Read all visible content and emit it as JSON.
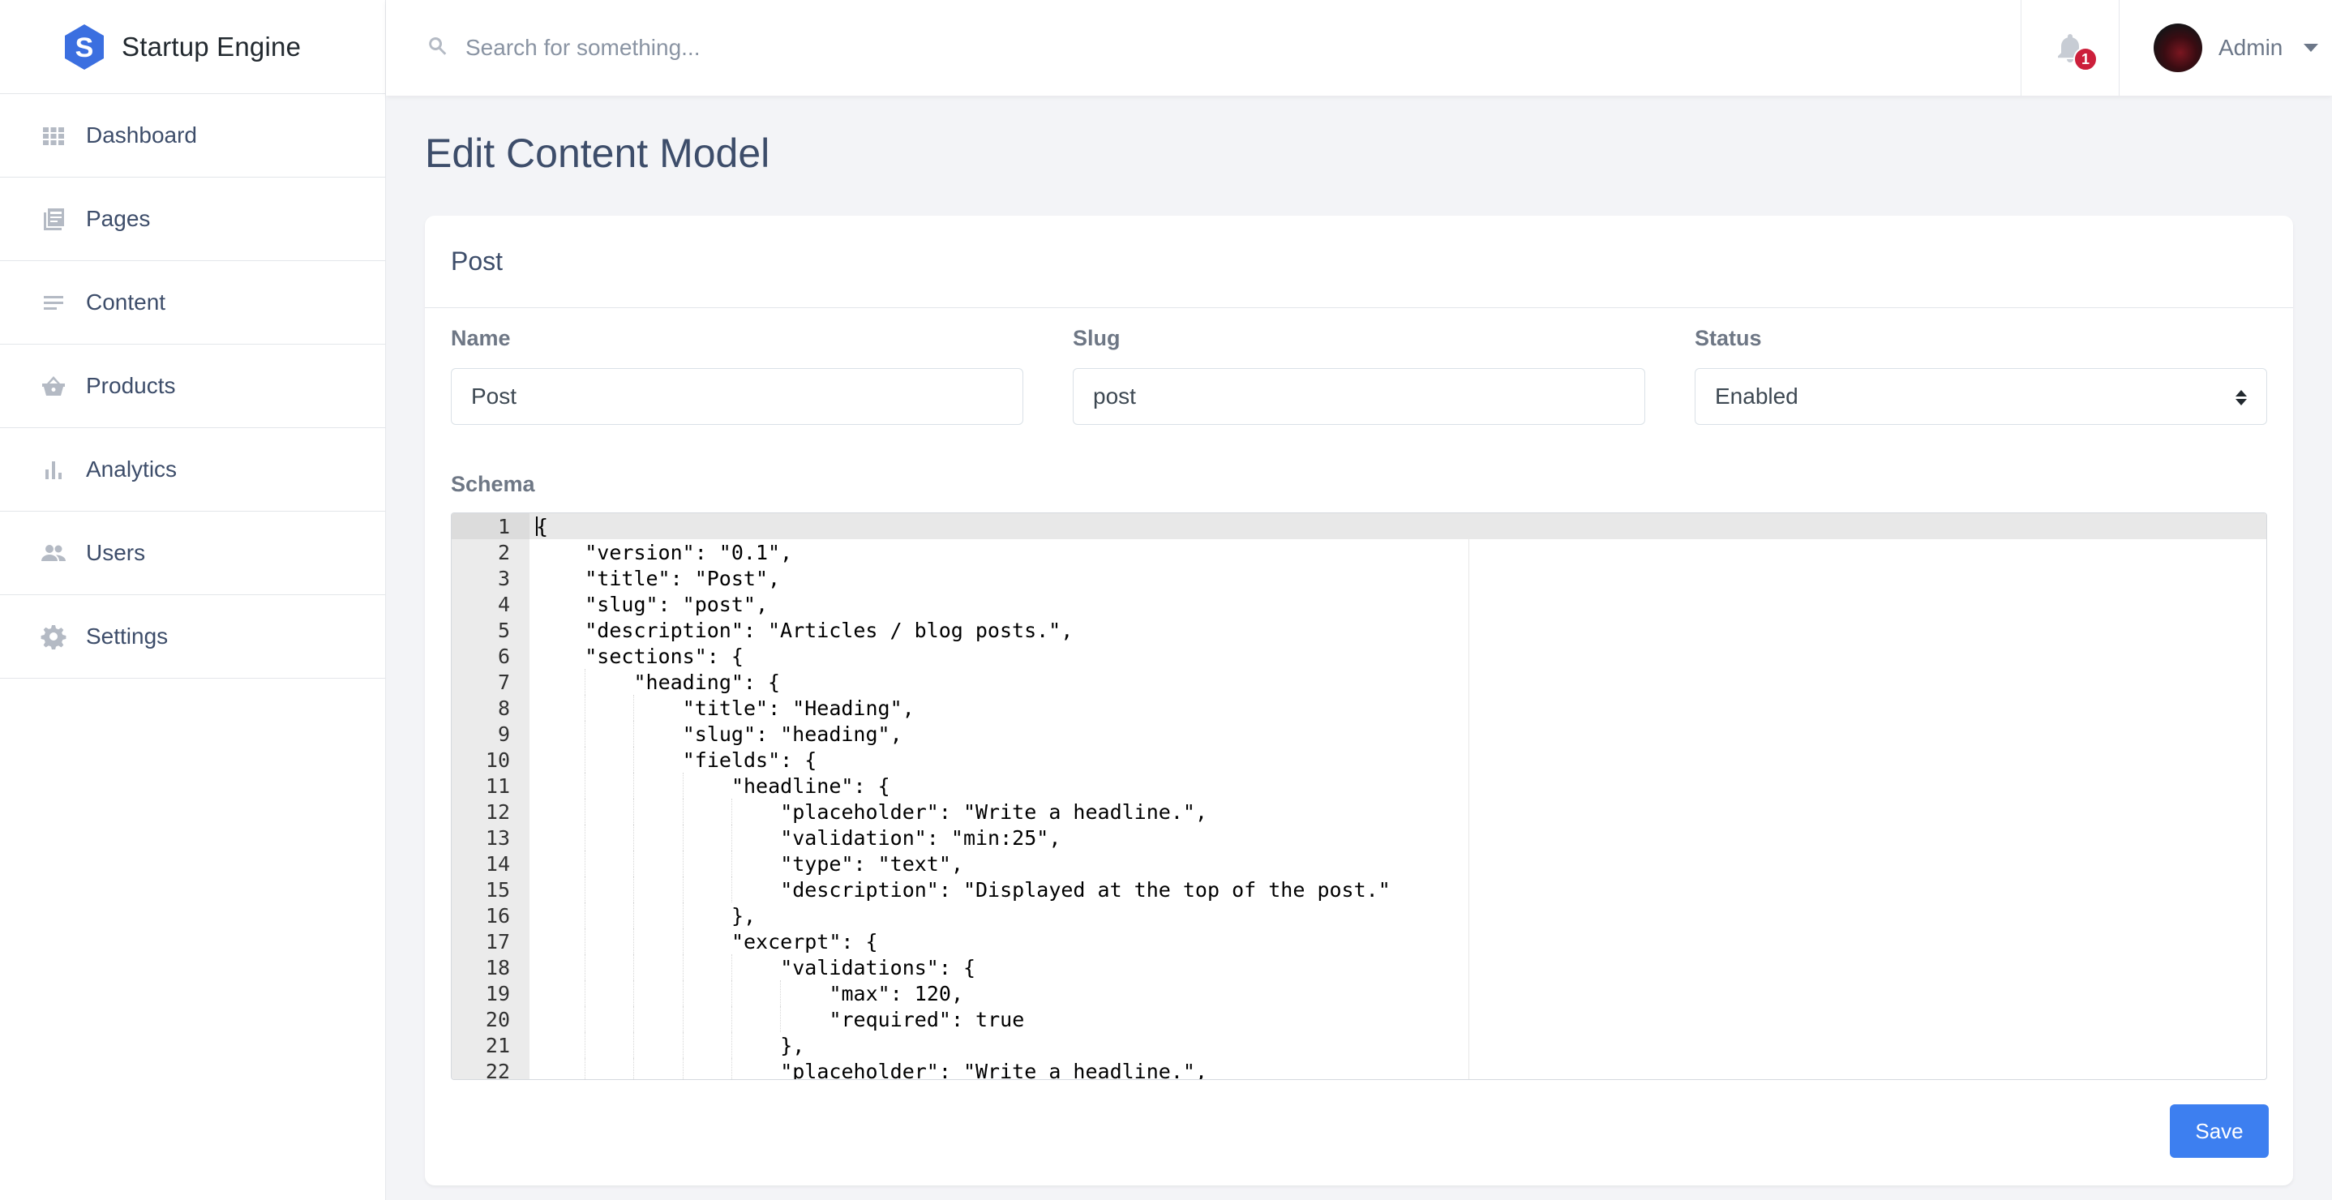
{
  "brand": {
    "name": "Startup Engine",
    "logo_letter": "S"
  },
  "sidebar": {
    "items": [
      {
        "label": "Dashboard",
        "icon": "grid-icon"
      },
      {
        "label": "Pages",
        "icon": "pages-icon"
      },
      {
        "label": "Content",
        "icon": "lines-icon"
      },
      {
        "label": "Products",
        "icon": "basket-icon"
      },
      {
        "label": "Analytics",
        "icon": "bar-chart-icon"
      },
      {
        "label": "Users",
        "icon": "users-icon"
      },
      {
        "label": "Settings",
        "icon": "gear-icon"
      }
    ]
  },
  "topbar": {
    "search_placeholder": "Search for something...",
    "notification_count": "1",
    "user_name": "Admin"
  },
  "page": {
    "title": "Edit Content Model"
  },
  "card": {
    "title": "Post",
    "name_label": "Name",
    "name_value": "Post",
    "slug_label": "Slug",
    "slug_value": "post",
    "status_label": "Status",
    "status_value": "Enabled",
    "schema_label": "Schema",
    "save_label": "Save"
  },
  "editor": {
    "lines": [
      {
        "n": "1",
        "indent": 0,
        "text": "{"
      },
      {
        "n": "2",
        "indent": 1,
        "text": "\"version\": \"0.1\","
      },
      {
        "n": "3",
        "indent": 1,
        "text": "\"title\": \"Post\","
      },
      {
        "n": "4",
        "indent": 1,
        "text": "\"slug\": \"post\","
      },
      {
        "n": "5",
        "indent": 1,
        "text": "\"description\": \"Articles / blog posts.\","
      },
      {
        "n": "6",
        "indent": 1,
        "text": "\"sections\": {"
      },
      {
        "n": "7",
        "indent": 2,
        "text": "\"heading\": {"
      },
      {
        "n": "8",
        "indent": 3,
        "text": "\"title\": \"Heading\","
      },
      {
        "n": "9",
        "indent": 3,
        "text": "\"slug\": \"heading\","
      },
      {
        "n": "10",
        "indent": 3,
        "text": "\"fields\": {"
      },
      {
        "n": "11",
        "indent": 4,
        "text": "\"headline\": {"
      },
      {
        "n": "12",
        "indent": 5,
        "text": "\"placeholder\": \"Write a headline.\","
      },
      {
        "n": "13",
        "indent": 5,
        "text": "\"validation\": \"min:25\","
      },
      {
        "n": "14",
        "indent": 5,
        "text": "\"type\": \"text\","
      },
      {
        "n": "15",
        "indent": 5,
        "text": "\"description\": \"Displayed at the top of the post.\""
      },
      {
        "n": "16",
        "indent": 4,
        "text": "},"
      },
      {
        "n": "17",
        "indent": 4,
        "text": "\"excerpt\": {"
      },
      {
        "n": "18",
        "indent": 5,
        "text": "\"validations\": {"
      },
      {
        "n": "19",
        "indent": 6,
        "text": "\"max\": 120,"
      },
      {
        "n": "20",
        "indent": 6,
        "text": "\"required\": true"
      },
      {
        "n": "21",
        "indent": 5,
        "text": "},"
      },
      {
        "n": "22",
        "indent": 5,
        "text": "\"placeholder\": \"Write a headline.\","
      }
    ]
  },
  "colors": {
    "accent": "#3d7ff0",
    "badge": "#cc1f3b",
    "logo": "#3b6fe0"
  }
}
